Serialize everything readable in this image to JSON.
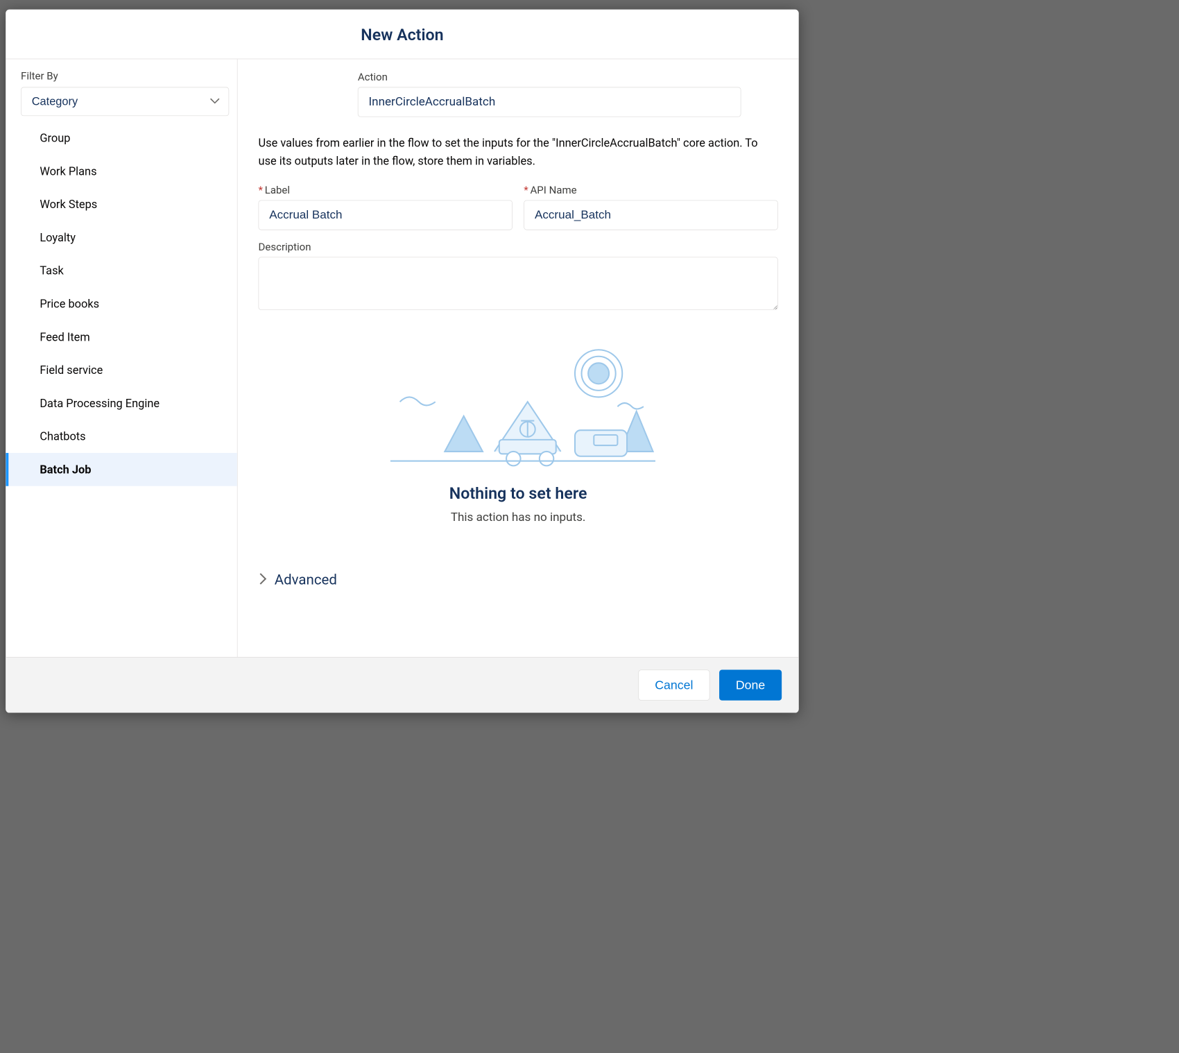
{
  "modal": {
    "title": "New Action"
  },
  "sidebar": {
    "filter_label": "Filter By",
    "filter_value": "Category",
    "items": [
      {
        "label": "Group",
        "active": false
      },
      {
        "label": "Work Plans",
        "active": false
      },
      {
        "label": "Work Steps",
        "active": false
      },
      {
        "label": "Loyalty",
        "active": false
      },
      {
        "label": "Task",
        "active": false
      },
      {
        "label": "Price books",
        "active": false
      },
      {
        "label": "Feed Item",
        "active": false
      },
      {
        "label": "Field service",
        "active": false
      },
      {
        "label": "Data Processing Engine",
        "active": false
      },
      {
        "label": "Chatbots",
        "active": false
      },
      {
        "label": "Batch Job",
        "active": true
      }
    ]
  },
  "form": {
    "action_label": "Action",
    "action_value": "InnerCircleAccrualBatch",
    "helper_text": "Use values from earlier in the flow to set the inputs for the \"InnerCircleAccrualBatch\" core action. To use its outputs later in the flow, store them in variables.",
    "label_label": "Label",
    "label_value": "Accrual Batch",
    "apiname_label": "API Name",
    "apiname_value": "Accrual_Batch",
    "description_label": "Description",
    "description_value": "",
    "empty_title": "Nothing to set here",
    "empty_sub": "This action has no inputs.",
    "advanced_label": "Advanced"
  },
  "footer": {
    "cancel": "Cancel",
    "done": "Done"
  }
}
